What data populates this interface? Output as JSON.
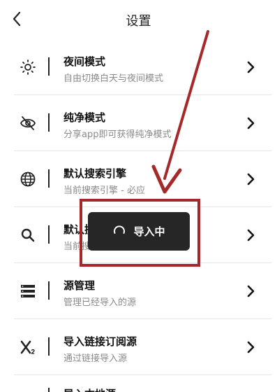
{
  "header": {
    "title": "设置",
    "back_icon": "chevron-left-icon"
  },
  "settings": [
    {
      "key": "night",
      "icon": "sun-icon",
      "title": "夜间模式",
      "subtitle": "自由切换白天与夜间模式"
    },
    {
      "key": "pure",
      "icon": "eye-slash-icon",
      "title": "纯净模式",
      "subtitle": "分享app即可获得纯净模式"
    },
    {
      "key": "engine",
      "icon": "globe-icon",
      "title": "默认搜索引擎",
      "subtitle": "当前搜索引擎 - 必应"
    },
    {
      "key": "search",
      "icon": "search-icon",
      "title": "默认搜索源",
      "subtitle": "当前搜索源"
    },
    {
      "key": "source",
      "icon": "list-icon",
      "title": "源管理",
      "subtitle": "管理已经导入的源"
    },
    {
      "key": "subscribe",
      "icon": "subscript-icon",
      "title": "导入链接订阅源",
      "subtitle": "通过链接导入源"
    }
  ],
  "partial_row": {
    "title": "导入本地源"
  },
  "toast": {
    "label": "导入中",
    "icon": "spinner-icon"
  },
  "colors": {
    "annotation": "#a6292a",
    "toast_bg": "#262626"
  }
}
